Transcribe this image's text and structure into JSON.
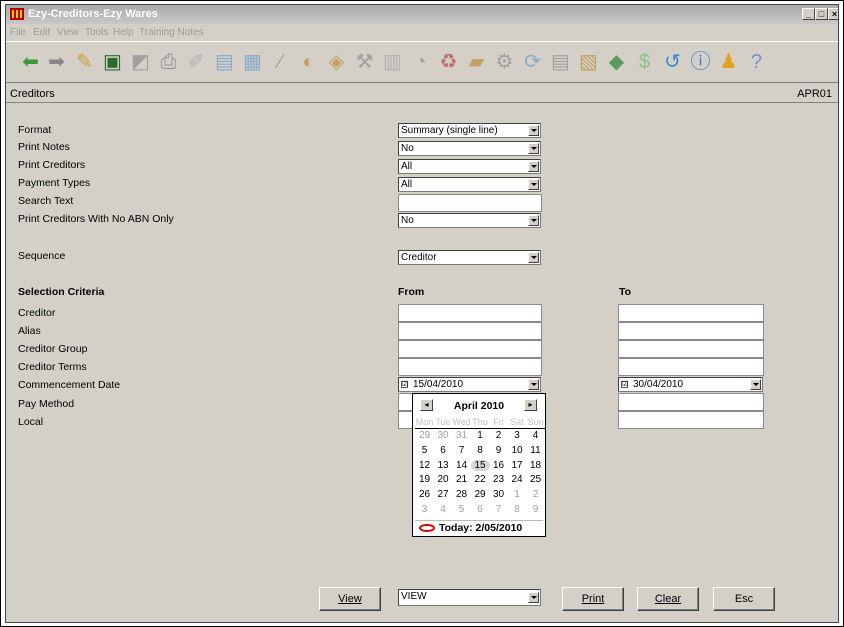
{
  "window": {
    "title": "Ezy-Creditors-Ezy Wares",
    "controls": [
      "minimize-icon",
      "maximize-icon",
      "close-icon"
    ]
  },
  "menu": {
    "items": [
      "File",
      "Edit",
      "View",
      "Tools",
      "Help",
      "Training Notes"
    ]
  },
  "toolbar": {
    "icons": [
      "back-arrow-icon",
      "forward-arrow-icon",
      "note-icon",
      "edit-icon",
      "chart-icon",
      "printer-icon",
      "tools-icon",
      "monitor-icon",
      "notes-icon",
      "pencil-icon",
      "disc-icon",
      "box-icon",
      "brush-icon",
      "column-icon",
      "chart-pie-icon",
      "recycle-icon",
      "folder-icon",
      "gear-icon",
      "refresh-icon",
      "list-icon",
      "package-icon",
      "money-icon",
      "dollar-icon",
      "undo-icon",
      "info-icon",
      "bulb-icon",
      "help-icon"
    ]
  },
  "screen": {
    "title": "Creditors",
    "code": "APR01"
  },
  "form": {
    "format_label": "Format",
    "format_value": "Summary (single line)",
    "print_notes_label": "Print Notes",
    "print_notes_value": "No",
    "print_creditors_label": "Print Creditors",
    "print_creditors_value": "All",
    "payment_types_label": "Payment Types",
    "payment_types_value": "All",
    "search_text_label": "Search Text",
    "search_text_value": "",
    "no_abn_label": "Print Creditors With No ABN Only",
    "no_abn_value": "No",
    "sequence_label": "Sequence",
    "sequence_value": "Creditor"
  },
  "criteria": {
    "heading": "Selection Criteria",
    "from_heading": "From",
    "to_heading": "To",
    "creditor_label": "Creditor",
    "alias_label": "Alias",
    "creditor_group_label": "Creditor Group",
    "creditor_terms_label": "Creditor Terms",
    "commencement_date_label": "Commencement Date",
    "pay_method_label": "Pay Method",
    "local_label": "Local",
    "commencement_from": "15/04/2010",
    "commencement_to": "30/04/2010",
    "check_mark": "☑"
  },
  "calendar": {
    "month": "April 2010",
    "prev": "◂",
    "next": "▸",
    "dow": [
      "Mon",
      "Tue",
      "Wed",
      "Thu",
      "Fri",
      "Sat",
      "Sun"
    ],
    "weeks": [
      [
        "29",
        "30",
        "31",
        "1",
        "2",
        "3",
        "4"
      ],
      [
        "5",
        "6",
        "7",
        "8",
        "9",
        "10",
        "11"
      ],
      [
        "12",
        "13",
        "14",
        "15",
        "16",
        "17",
        "18"
      ],
      [
        "19",
        "20",
        "21",
        "22",
        "23",
        "24",
        "25"
      ],
      [
        "26",
        "27",
        "28",
        "29",
        "30",
        "1",
        "2"
      ],
      [
        "3",
        "4",
        "5",
        "6",
        "7",
        "8",
        "9"
      ]
    ],
    "selected_day": "15",
    "today_label": "Today: 2/05/2010"
  },
  "bottom": {
    "view_button": "View",
    "output_value": "VIEW",
    "print_button": "Print",
    "clear_button": "Clear",
    "esc_button": "Esc"
  }
}
